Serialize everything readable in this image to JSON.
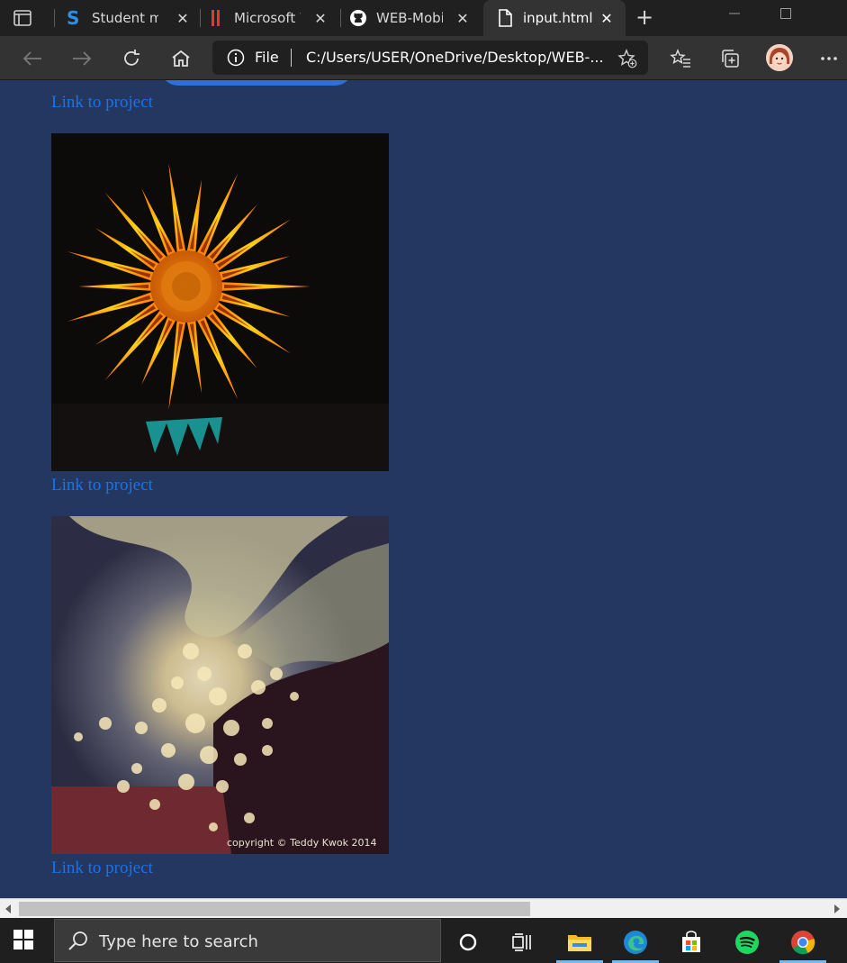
{
  "browser": {
    "tabs": [
      {
        "label": "Student ma",
        "icon": "skype-s-icon",
        "active": false
      },
      {
        "label": "Microsoft W",
        "icon": "pause-bars-icon",
        "active": false
      },
      {
        "label": "WEB-Mobil",
        "icon": "github-icon",
        "active": false
      },
      {
        "label": "input.html",
        "icon": "file-icon",
        "active": true
      }
    ],
    "address": {
      "scheme": "File",
      "url": "C:/Users/USER/OneDrive/Desktop/WEB-..."
    }
  },
  "page": {
    "links": [
      {
        "text": "Link to project"
      },
      {
        "text": "Link to project"
      },
      {
        "text": "Link to project"
      }
    ],
    "images": [
      {
        "name": "orange-gazania-flower",
        "watermark": ""
      },
      {
        "name": "sunlight-through-trees",
        "watermark": "copyright © Teddy Kwok 2014"
      }
    ]
  },
  "taskbar": {
    "search_placeholder": "Type here to search",
    "apps": [
      "cortana-icon",
      "task-view-icon",
      "file-explorer-icon",
      "edge-icon",
      "store-icon",
      "spotify-icon",
      "chrome-icon"
    ]
  },
  "colors": {
    "page_bg": "#233760",
    "link": "#1a73e8",
    "titlebar": "#202020",
    "toolbar": "#333333"
  }
}
